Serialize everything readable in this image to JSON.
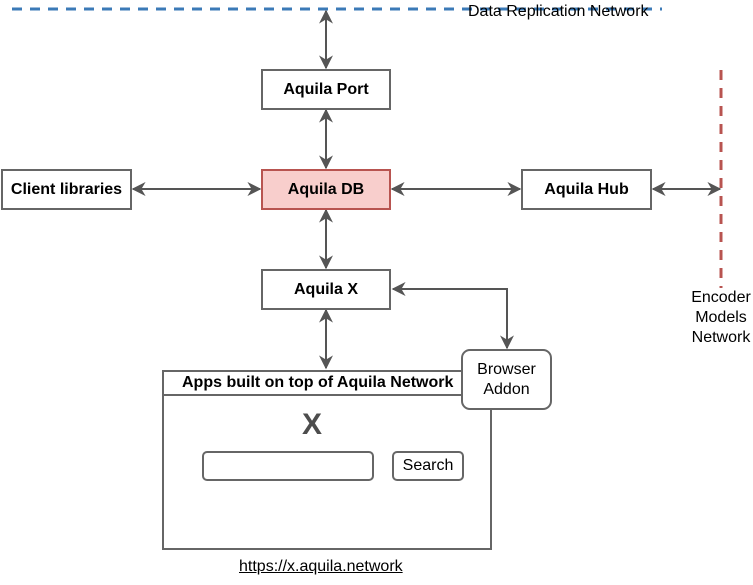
{
  "networks": {
    "data_replication": {
      "label": "Data Replication Network",
      "color": "#3b7ab7"
    },
    "encoder_models": {
      "label_lines": [
        "Encoder",
        "Models",
        "Network"
      ],
      "color": "#b85450"
    }
  },
  "nodes": {
    "aquila_port": "Aquila Port",
    "aquila_db": "Aquila DB",
    "client_libraries": "Client libraries",
    "aquila_hub": "Aquila Hub",
    "aquila_x": "Aquila X",
    "browser_addon_lines": [
      "Browser",
      "Addon"
    ]
  },
  "app": {
    "title": "Apps built on top of Aquila Network",
    "logo": "X",
    "search_input_value": "",
    "search_button": "Search",
    "url": "https://x.aquila.network"
  },
  "colors": {
    "stroke": "#666666",
    "db_fill": "#f8cecc",
    "db_stroke": "#b85450"
  }
}
